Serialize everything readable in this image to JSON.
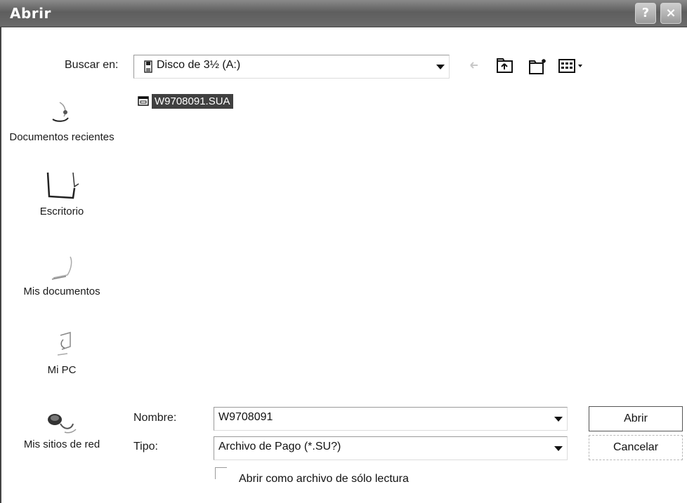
{
  "window": {
    "title": "Abrir",
    "help_icon": "?",
    "close_icon": "×"
  },
  "look_in": {
    "label": "Buscar en:",
    "value": "Disco de 3½ (A:)",
    "icon": "floppy-drive-icon"
  },
  "toolbar": {
    "back_icon": "back-arrow-icon",
    "up_icon": "up-folder-icon",
    "new_folder_icon": "new-folder-icon",
    "view_icon": "view-menu-icon"
  },
  "places": [
    {
      "label": "Documentos recientes",
      "icon": "recent-documents-icon"
    },
    {
      "label": "Escritorio",
      "icon": "desktop-icon"
    },
    {
      "label": "Mis documentos",
      "icon": "my-documents-icon"
    },
    {
      "label": "Mi PC",
      "icon": "my-computer-icon"
    },
    {
      "label": "Mis sitios de red",
      "icon": "network-places-icon"
    }
  ],
  "files": [
    {
      "name": "W9708091.SUA",
      "selected": true,
      "icon": "file-icon"
    }
  ],
  "filename": {
    "label": "Nombre:",
    "value": "W9708091"
  },
  "filetype": {
    "label": "Tipo:",
    "value": "Archivo de Pago (*.SU?)"
  },
  "readonly": {
    "label": "Abrir como archivo de sólo lectura",
    "checked": false
  },
  "buttons": {
    "open": "Abrir",
    "cancel": "Cancelar"
  },
  "colors": {
    "titlebar": "#6a6a6a",
    "selection": "#404040"
  }
}
